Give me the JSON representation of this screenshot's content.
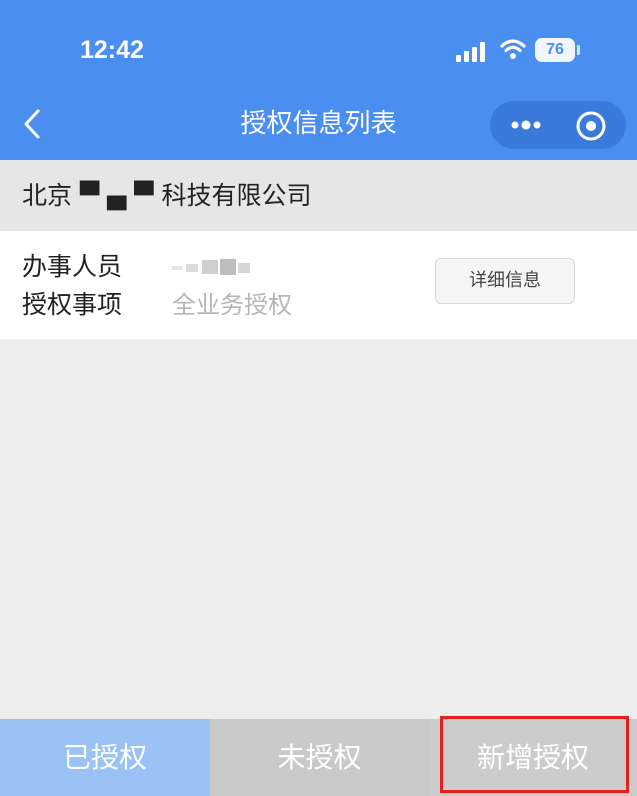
{
  "status_bar": {
    "time": "12:42",
    "battery": "76"
  },
  "nav": {
    "title": "授权信息列表",
    "back_icon": "chevron-left-icon",
    "more_icon": "more-dots-icon",
    "close_icon": "target-icon"
  },
  "company": {
    "name": "北京 ▀ ▄ ▀ 科技有限公司"
  },
  "record": {
    "agent_label": "办事人员",
    "agent_value": "",
    "scope_label": "授权事项",
    "scope_value": "全业务授权",
    "detail_button": "详细信息"
  },
  "tabs": [
    {
      "label": "已授权"
    },
    {
      "label": "未授权"
    },
    {
      "label": "新增授权"
    }
  ],
  "colors": {
    "primary": "#4a8ef0",
    "tab_active": "#9ac2f4",
    "tab_inactive": "#c9c9c9",
    "highlight": "#e3201b"
  }
}
